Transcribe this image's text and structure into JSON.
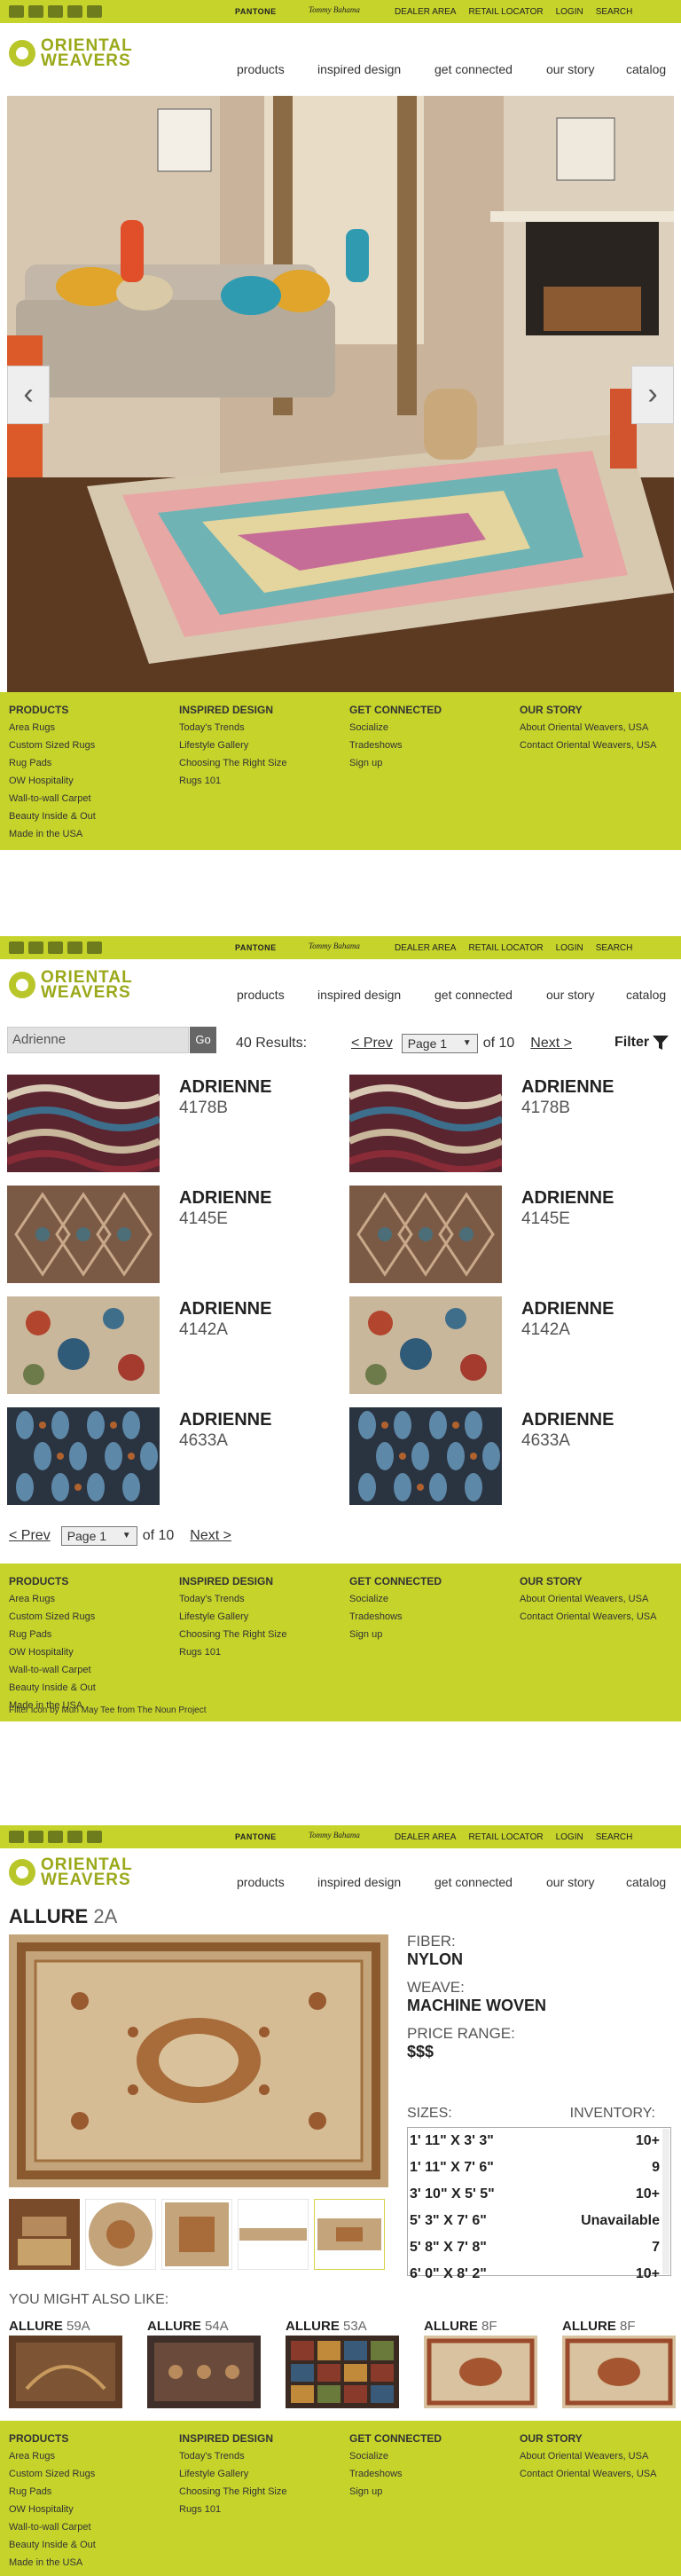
{
  "header": {
    "brand_pantone": "PANTONE",
    "brand_tb": "Tommy Bahama",
    "top_links": [
      "DEALER AREA",
      "RETAIL LOCATOR",
      "LOGIN",
      "SEARCH"
    ],
    "logo_top": "ORIENTAL",
    "logo_bottom": "WEAVERS",
    "nav": [
      "products",
      "inspired design",
      "get connected",
      "our story",
      "catalog"
    ]
  },
  "footer": {
    "products": {
      "title": "PRODUCTS",
      "items": [
        "Area Rugs",
        "Custom Sized Rugs",
        "Rug Pads",
        "OW Hospitality",
        "Wall-to-wall Carpet",
        "Beauty Inside & Out",
        "Made in the USA"
      ]
    },
    "inspired": {
      "title": "INSPIRED DESIGN",
      "items": [
        "Today's Trends",
        "Lifestyle Gallery",
        "Choosing The Right Size",
        "Rugs 101"
      ]
    },
    "connected": {
      "title": "GET CONNECTED",
      "items": [
        "Socialize",
        "Tradeshows",
        "Sign up"
      ]
    },
    "story": {
      "title": "OUR STORY",
      "items": [
        "About Oriental Weavers, USA",
        "Contact Oriental Weavers, USA"
      ]
    },
    "credit": "Filter icon by Mun May Tee from The Noun Project"
  },
  "search": {
    "query": "Adrienne",
    "go": "Go",
    "results": "40 Results:",
    "prev": "< Prev",
    "next": "Next >",
    "page_select": "Page 1",
    "of": "of 10",
    "filter": "Filter"
  },
  "products": [
    {
      "name": "ADRIENNE",
      "code": "4178B"
    },
    {
      "name": "ADRIENNE",
      "code": "4178B"
    },
    {
      "name": "ADRIENNE",
      "code": "4145E"
    },
    {
      "name": "ADRIENNE",
      "code": "4145E"
    },
    {
      "name": "ADRIENNE",
      "code": "4142A"
    },
    {
      "name": "ADRIENNE",
      "code": "4142A"
    },
    {
      "name": "ADRIENNE",
      "code": "4633A"
    },
    {
      "name": "ADRIENNE",
      "code": "4633A"
    }
  ],
  "detail": {
    "title": "ALLURE",
    "code": "2A",
    "fiber_label": "FIBER:",
    "fiber": "NYLON",
    "weave_label": "WEAVE:",
    "weave": "MACHINE WOVEN",
    "price_label": "PRICE RANGE:",
    "price": "$$$",
    "sizes_label": "SIZES:",
    "inventory_label": "INVENTORY:",
    "sizes": [
      {
        "size": "1' 11\" X 3' 3\"",
        "inv": "10+"
      },
      {
        "size": "1' 11\" X 7' 6\"",
        "inv": "9"
      },
      {
        "size": "3' 10\" X 5' 5\"",
        "inv": "10+"
      },
      {
        "size": "5' 3\" X 7' 6\"",
        "inv": "Unavailable"
      },
      {
        "size": "5' 8\" X 7' 8\"",
        "inv": "7"
      },
      {
        "size": "6' 0\" X 8' 2\"",
        "inv": "10+"
      }
    ],
    "also_like": "YOU MIGHT ALSO LIKE:",
    "similar": [
      {
        "name": "ALLURE",
        "code": "59A"
      },
      {
        "name": "ALLURE",
        "code": "54A"
      },
      {
        "name": "ALLURE",
        "code": "53A"
      },
      {
        "name": "ALLURE",
        "code": "8F"
      },
      {
        "name": "ALLURE",
        "code": "8F"
      }
    ]
  }
}
